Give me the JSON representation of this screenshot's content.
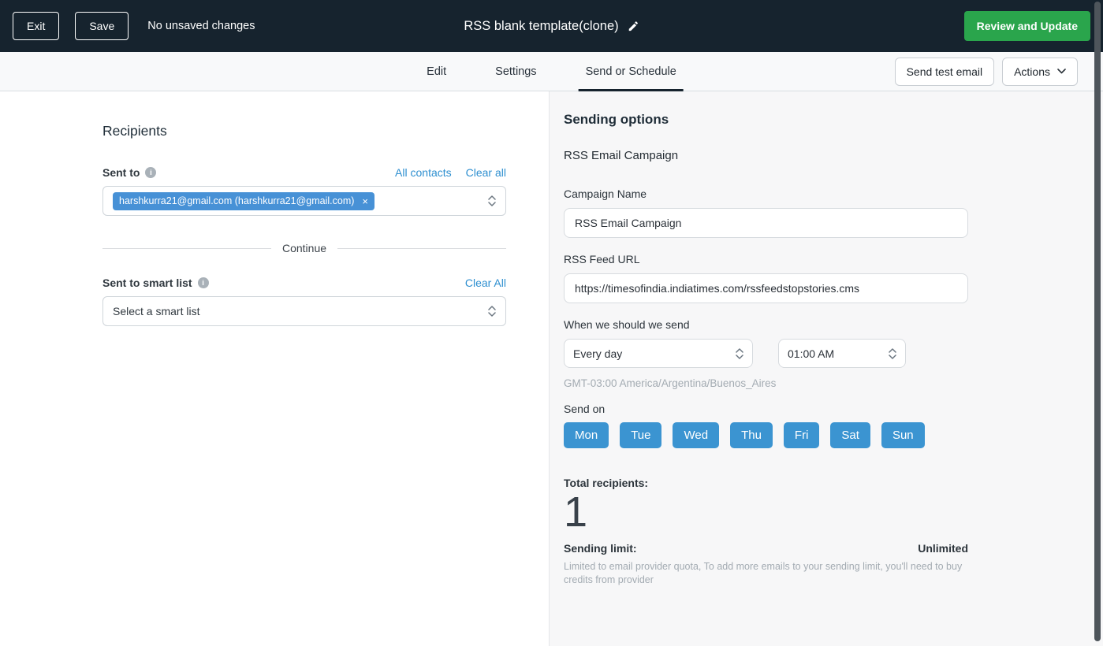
{
  "topbar": {
    "exit_label": "Exit",
    "save_label": "Save",
    "status": "No unsaved changes",
    "title": "RSS blank template(clone)",
    "review_label": "Review and Update"
  },
  "tabs": {
    "items": [
      {
        "label": "Edit",
        "active": false
      },
      {
        "label": "Settings",
        "active": false
      },
      {
        "label": "Send or Schedule",
        "active": true
      }
    ],
    "send_test_label": "Send test email",
    "actions_label": "Actions"
  },
  "recipients": {
    "heading": "Recipients",
    "sent_to_label": "Sent to",
    "all_contacts_link": "All contacts",
    "clear_all_link": "Clear all",
    "chip": "harshkurra21@gmail.com (harshkurra21@gmail.com)",
    "continue_label": "Continue",
    "smart_list_label": "Sent to smart list",
    "smart_list_clear_link": "Clear All",
    "smart_list_placeholder": "Select a smart list"
  },
  "sending": {
    "heading": "Sending options",
    "subheading": "RSS Email Campaign",
    "campaign_name_label": "Campaign Name",
    "campaign_name_value": "RSS Email Campaign",
    "rss_feed_label": "RSS Feed URL",
    "rss_feed_value": "https://timesofindia.indiatimes.com/rssfeedstopstories.cms",
    "when_label": "When we should we send",
    "frequency_value": "Every day",
    "time_value": "01:00 AM",
    "timezone": "GMT-03:00 America/Argentina/Buenos_Aires",
    "send_on_label": "Send on",
    "days": [
      "Mon",
      "Tue",
      "Wed",
      "Thu",
      "Fri",
      "Sat",
      "Sun"
    ],
    "total_recipients_label": "Total recipients:",
    "total_recipients_value": "1",
    "sending_limit_label": "Sending limit:",
    "sending_limit_value": "Unlimited",
    "sending_limit_note": "Limited to email provider quota, To add more emails to your sending limit, you'll need to buy credits from provider"
  },
  "icons": {
    "info": "i",
    "close": "×"
  },
  "colors": {
    "topbar_bg": "#16232e",
    "green": "#2aa54c",
    "link_blue": "#2e8fd0",
    "chip_blue": "#4791d6",
    "day_blue": "#3b94d1",
    "panel_bg": "#f7f7f8"
  }
}
